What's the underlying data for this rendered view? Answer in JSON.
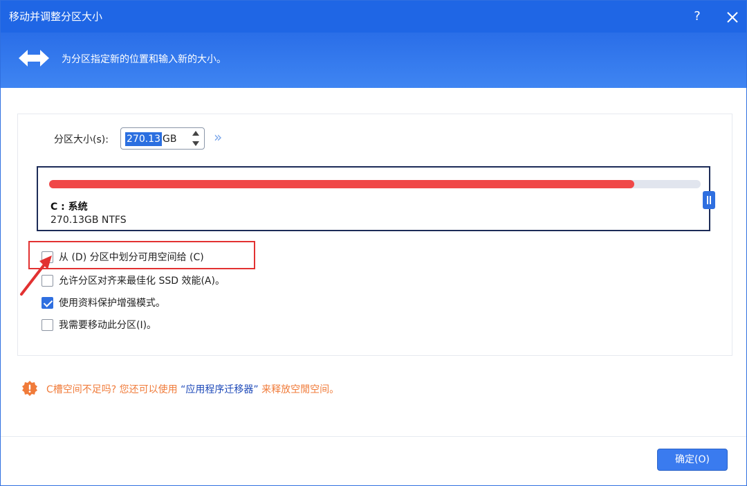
{
  "window": {
    "title": "移动并调整分区大小",
    "help_label": "?"
  },
  "banner": {
    "icon": "double-arrow-icon",
    "text": "为分区指定新的位置和输入新的大小。"
  },
  "size": {
    "label": "分区大小(s):",
    "value": "270.13",
    "unit": "GB",
    "expand_label": "»"
  },
  "partition": {
    "name": "C : 系统",
    "info": "270.13GB NTFS",
    "used_fraction": 0.898,
    "used_color": "#f04848"
  },
  "options": [
    {
      "label": "从 (D) 分区中划分可用空间给 (C)",
      "checked": false
    },
    {
      "label": "允许分区对齐来最佳化 SSD 效能(A)。",
      "checked": false
    },
    {
      "label": "使用资料保护增强模式。",
      "checked": true
    },
    {
      "label": "我需要移动此分区(I)。",
      "checked": false
    }
  ],
  "tip": {
    "icon": "gear-warning-icon",
    "pre": "C槽空间不足吗? 您还可以使用",
    "link": "“应用程序迁移器”",
    "post": "来释放空閒空间。"
  },
  "footer": {
    "ok_label": "确定(O)"
  },
  "colors": {
    "titlebar": "#1f66e5",
    "accent": "#3a7bef",
    "highlight": "#e23131"
  }
}
